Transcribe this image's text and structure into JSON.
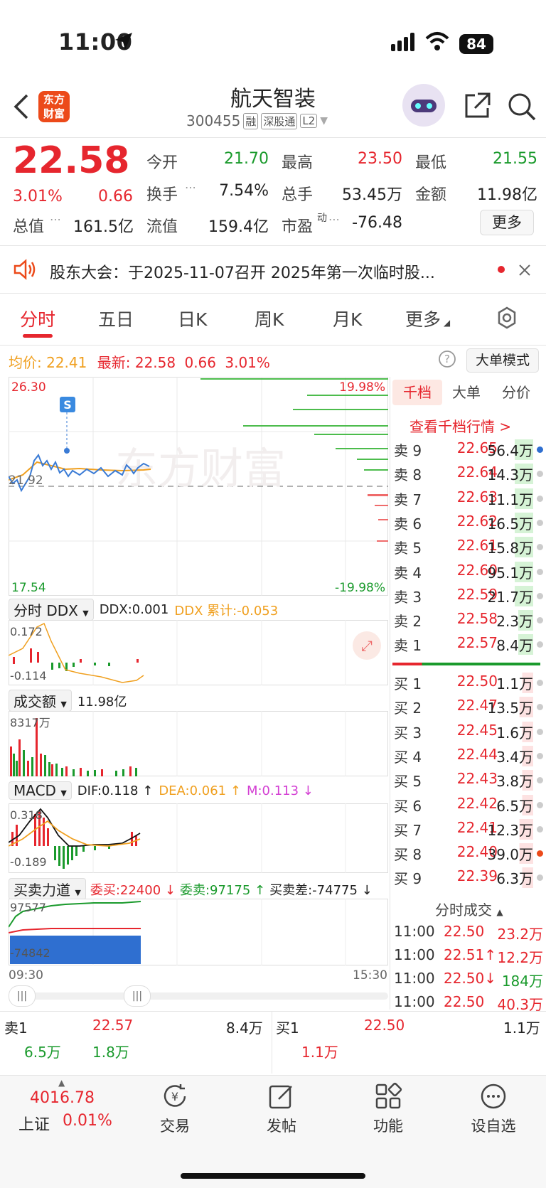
{
  "status_bar": {
    "time": "11:00",
    "battery": "84"
  },
  "header": {
    "logo": "东方财富",
    "name": "航天智装",
    "code": "300455",
    "tags": [
      "融",
      "深股通",
      "L2"
    ]
  },
  "quote": {
    "price": "22.58",
    "change_pct": "3.01%",
    "change": "0.66",
    "open_label": "今开",
    "open": "21.70",
    "high_label": "最高",
    "high": "23.50",
    "low_label": "最低",
    "low": "21.55",
    "turnover_label": "换手",
    "turnover": "7.54%",
    "volume_label": "总手",
    "volume": "53.45万",
    "amount_label": "金额",
    "amount": "11.98亿",
    "mcap_label": "总值",
    "mcap": "161.5亿",
    "float_label": "流值",
    "float": "159.4亿",
    "pe_label": "市盈",
    "pe_sup": "动",
    "pe": "-76.48",
    "more": "更多"
  },
  "notice": {
    "text": "股东大会：于2025-11-07召开 2025年第一次临时股..."
  },
  "tabs": [
    "分时",
    "五日",
    "日K",
    "周K",
    "月K",
    "更多"
  ],
  "chart_header": {
    "avg_label": "均价:",
    "avg": "22.41",
    "latest_label": "最新:",
    "latest": "22.58",
    "chg": "0.66",
    "pct": "3.01%",
    "big_order": "大单模式"
  },
  "main_chart": {
    "top": "26.30",
    "bottom": "17.54",
    "mid": "21.92",
    "top_pct": "19.98%",
    "bottom_pct": "-19.98%",
    "marker": "S",
    "watermark": "东方财富"
  },
  "ddx": {
    "button": "分时 DDX",
    "ddx": "DDX:0.001",
    "ddx_sum": "DDX 累计:-0.053",
    "top": "0.172",
    "bottom": "-0.114"
  },
  "volume_panel": {
    "button": "成交额",
    "total": "11.98亿",
    "max": "8317万"
  },
  "macd": {
    "button": "MACD",
    "dif": "DIF:0.118 ↑",
    "dea": "DEA:0.061 ↑",
    "m": "M:0.113 ↓",
    "top": "0.318",
    "bottom": "-0.189"
  },
  "force": {
    "button": "买卖力道",
    "wb": "委买:22400 ↓",
    "ws": "委卖:97175 ↑",
    "diff": "买卖差:-74775 ↓",
    "top": "97577",
    "bottom": "-74842"
  },
  "time_axis": {
    "start": "09:30",
    "end": "15:30"
  },
  "orderbook": {
    "tabs": [
      "千档",
      "大单",
      "分价"
    ],
    "link": "查看千档行情 >",
    "asks": [
      {
        "label": "卖 9",
        "price": "22.65",
        "vol": "56.4万"
      },
      {
        "label": "卖 8",
        "price": "22.64",
        "vol": "14.3万"
      },
      {
        "label": "卖 7",
        "price": "22.63",
        "vol": "11.1万"
      },
      {
        "label": "卖 6",
        "price": "22.62",
        "vol": "16.5万"
      },
      {
        "label": "卖 5",
        "price": "22.61",
        "vol": "15.8万"
      },
      {
        "label": "卖 4",
        "price": "22.60",
        "vol": "95.1万"
      },
      {
        "label": "卖 3",
        "price": "22.59",
        "vol": "21.7万"
      },
      {
        "label": "卖 2",
        "price": "22.58",
        "vol": "2.3万"
      },
      {
        "label": "卖 1",
        "price": "22.57",
        "vol": "8.4万"
      }
    ],
    "bids": [
      {
        "label": "买 1",
        "price": "22.50",
        "vol": "1.1万"
      },
      {
        "label": "买 2",
        "price": "22.47",
        "vol": "13.5万"
      },
      {
        "label": "买 3",
        "price": "22.45",
        "vol": "1.6万"
      },
      {
        "label": "买 4",
        "price": "22.44",
        "vol": "3.4万"
      },
      {
        "label": "买 5",
        "price": "22.43",
        "vol": "3.8万"
      },
      {
        "label": "买 6",
        "price": "22.42",
        "vol": "6.5万"
      },
      {
        "label": "买 7",
        "price": "22.41",
        "vol": "12.3万"
      },
      {
        "label": "买 8",
        "price": "22.40",
        "vol": "39.0万"
      },
      {
        "label": "买 9",
        "price": "22.39",
        "vol": "6.3万"
      }
    ],
    "trades_title": "分时成交",
    "trades": [
      {
        "time": "11:00",
        "price": "22.50",
        "vol": "23.2万"
      },
      {
        "time": "11:00",
        "price": "22.51↑",
        "vol": "12.2万"
      },
      {
        "time": "11:00",
        "price": "22.50↓",
        "vol": "184万"
      },
      {
        "time": "11:00",
        "price": "22.50",
        "vol": "40.3万"
      }
    ]
  },
  "bottom_quote": {
    "ask_label": "卖1",
    "ask_price": "22.57",
    "ask_vol": "8.4万",
    "ask_a": "6.5万",
    "ask_b": "1.8万",
    "bid_label": "买1",
    "bid_price": "22.50",
    "bid_vol": "1.1万",
    "bid_a": "1.1万"
  },
  "bottom_nav": {
    "index_value": "4016.78",
    "index_name": "上证",
    "index_pct": "0.01%",
    "items": [
      "交易",
      "发帖",
      "功能",
      "设自选"
    ]
  }
}
